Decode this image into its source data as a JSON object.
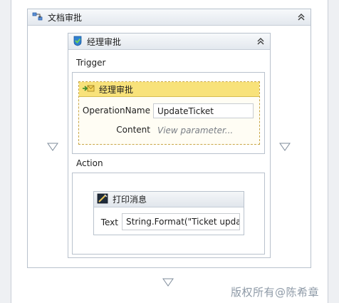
{
  "outer_sequence": {
    "title": "文档审批"
  },
  "inner_sequence": {
    "title": "经理审批"
  },
  "trigger": {
    "label": "Trigger",
    "receive": {
      "title": "经理审批",
      "operation_label": "OperationName",
      "operation_value": "UpdateTicket",
      "content_label": "Content",
      "content_placeholder": "View parameter..."
    }
  },
  "action": {
    "label": "Action",
    "write_line": {
      "title": "打印消息",
      "text_label": "Text",
      "text_value": "String.Format(\"Ticket update"
    }
  },
  "watermark": "版权所有@陈希章",
  "icons": [
    "sequence-icon",
    "collapse-icon",
    "pick-branch-icon",
    "receive-icon",
    "writeline-icon",
    "drop-target-arrow-icon"
  ]
}
